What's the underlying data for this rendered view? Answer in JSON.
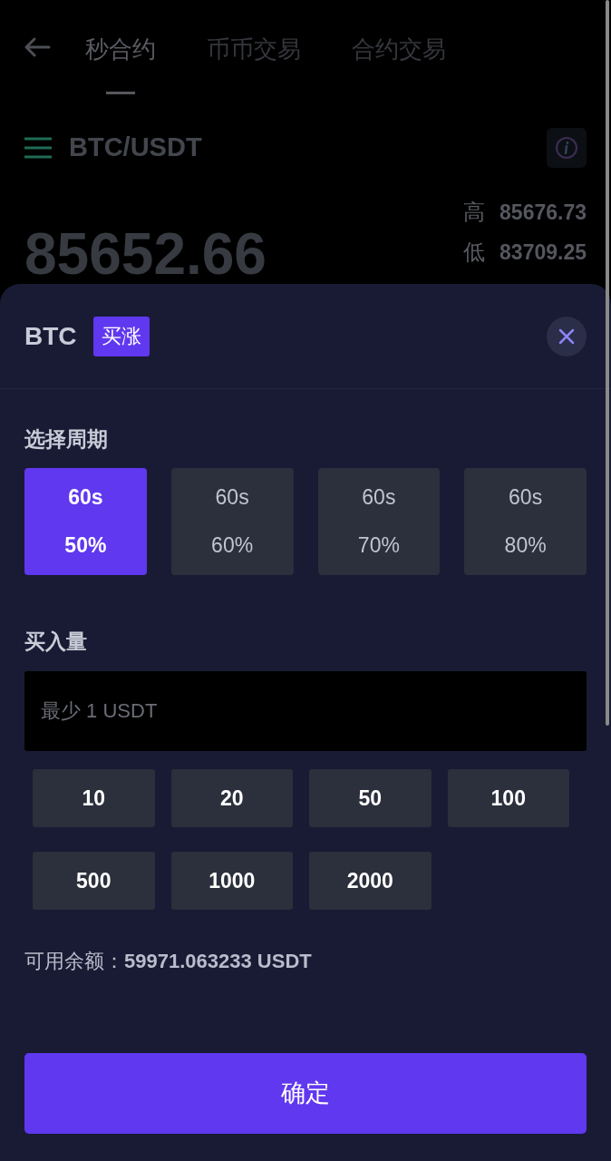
{
  "tabs": [
    {
      "label": "秒合约",
      "selected": true
    },
    {
      "label": "币币交易",
      "selected": false
    },
    {
      "label": "合约交易",
      "selected": false
    }
  ],
  "pair": {
    "symbol": "BTC/USDT"
  },
  "price": "85652.66",
  "stats": [
    {
      "label": "高",
      "value": "85676.73"
    },
    {
      "label": "低",
      "value": "83709.25"
    }
  ],
  "order_sheet": {
    "asset": "BTC",
    "direction": "买涨",
    "period_label": "选择周期",
    "periods": [
      {
        "duration": "60s",
        "rate": "50%",
        "selected": true
      },
      {
        "duration": "60s",
        "rate": "60%",
        "selected": false
      },
      {
        "duration": "60s",
        "rate": "70%",
        "selected": false
      },
      {
        "duration": "60s",
        "rate": "80%",
        "selected": false
      }
    ],
    "amount_label": "买入量",
    "amount_field": {
      "placeholder": "最少 1 USDT"
    },
    "amounts": [
      "10",
      "20",
      "50",
      "100",
      "500",
      "1000",
      "2000"
    ],
    "balance_label": "可用余额：",
    "balance": "59971.063233 USDT",
    "confirm": "确定"
  }
}
